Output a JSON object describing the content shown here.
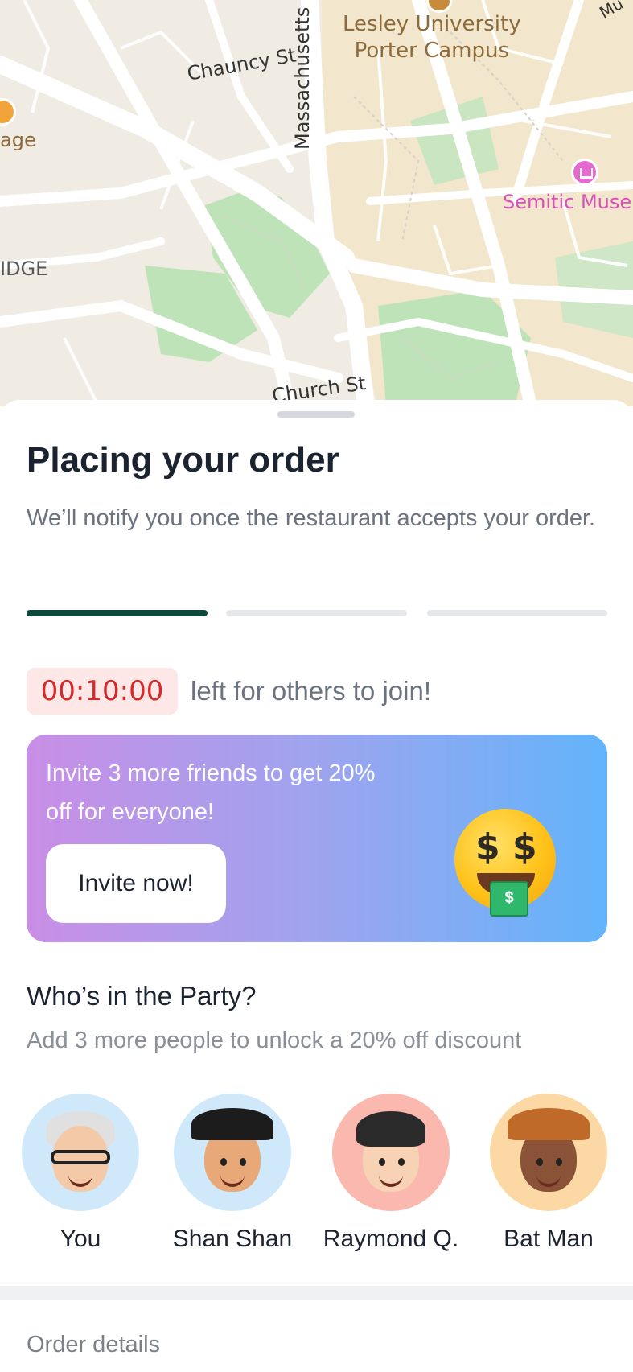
{
  "map": {
    "streets": [
      "Chauncy St",
      "Massachusetts",
      "Church St"
    ],
    "places": [
      "Lesley University",
      "Porter Campus",
      "Semitic Muse"
    ],
    "partial_labels": [
      "age",
      "IDGE",
      "Mu"
    ]
  },
  "order": {
    "title": "Placing your order",
    "subtitle": "We’ll notify you once the restaurant accepts your order.",
    "progress_step": 1,
    "progress_total": 3
  },
  "timer": {
    "value": "00:10:00",
    "text": "left for others to join!"
  },
  "promo": {
    "text": "Invite 3 more friends to get 20% off for everyone!",
    "button_label": "Invite now!",
    "emoji": "money-mouth-face",
    "emoji_symbol": "$"
  },
  "party": {
    "title": "Who’s in the Party?",
    "subtitle": "Add 3 more people to unlock a 20% off discount",
    "members": [
      {
        "name": "You",
        "color": "#cfe9fb"
      },
      {
        "name": "Shan Shan",
        "color": "#cfe9fb"
      },
      {
        "name": "Raymond Q.",
        "color": "#fbb8ae"
      },
      {
        "name": "Bat Man",
        "color": "#fcd9a4"
      }
    ]
  },
  "order_details": {
    "label": "Order details"
  },
  "colors": {
    "progress_active": "#0d4a3c",
    "timer": "#d42a2a",
    "banner_start": "#c98ee6",
    "banner_end": "#62b4fb"
  }
}
